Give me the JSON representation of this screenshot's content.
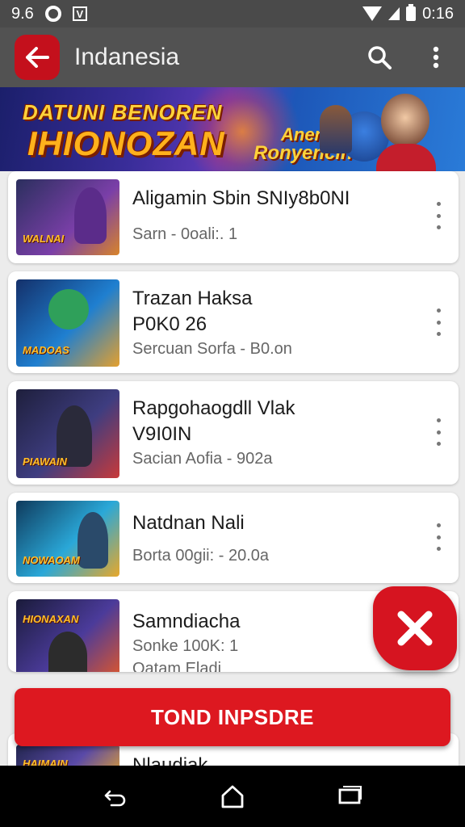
{
  "status_bar": {
    "left_text": "9.6",
    "time": "0:16"
  },
  "app_bar": {
    "title": "Indanesia"
  },
  "banner": {
    "headline_top": "DATUNI BENOREN",
    "headline_main": "IHIONOZAN",
    "side_line_1": "Anen",
    "side_line_2": "Ronyencin"
  },
  "items": [
    {
      "title": "Aligamin Sbin SNIy8b0NI",
      "subtitle": "Sarn - 0oali:. 1",
      "thumb_caption": "WALNAI",
      "thumb_colors": [
        "#2b2f5e",
        "#7a3fa8",
        "#d8842a"
      ]
    },
    {
      "title": "Trazan Haksa\nP0K0 26",
      "subtitle": "Sercuan Sorfa - B0.on",
      "thumb_caption": "MADOAS",
      "thumb_colors": [
        "#14306a",
        "#1f7fd0",
        "#e4a02e"
      ]
    },
    {
      "title": "Rapgohaogdll Vlak\nV9I0IN",
      "subtitle": "Sacian Aofia - 902a",
      "thumb_caption": "PIAWAIN",
      "thumb_colors": [
        "#1e1f3c",
        "#3e3d80",
        "#c83a3a"
      ]
    },
    {
      "title": "Natdnan Nali",
      "subtitle": "Borta 00gii: - 20.0a",
      "thumb_caption": "NOWAOAM",
      "thumb_colors": [
        "#0f3a5c",
        "#2aa8d8",
        "#e8a82a"
      ]
    },
    {
      "title": "Samndiacha",
      "subtitle": "Sonke 100K: 1",
      "subtitle_2": "Oatam Eladi",
      "thumb_caption": "HIONAXAN",
      "thumb_colors": [
        "#1a1b3a",
        "#4b3b9a",
        "#e0572a"
      ]
    },
    {
      "title": "Nlaudiak",
      "subtitle": "",
      "thumb_caption": "HAIMAIN",
      "thumb_colors": [
        "#23264f",
        "#5a4aa8",
        "#e3a12c"
      ]
    }
  ],
  "cta": {
    "label": "TOND INPSDRE"
  },
  "colors": {
    "accent": "#dd1820",
    "app_bar": "#525252",
    "status_bar": "#4a4a4a"
  }
}
